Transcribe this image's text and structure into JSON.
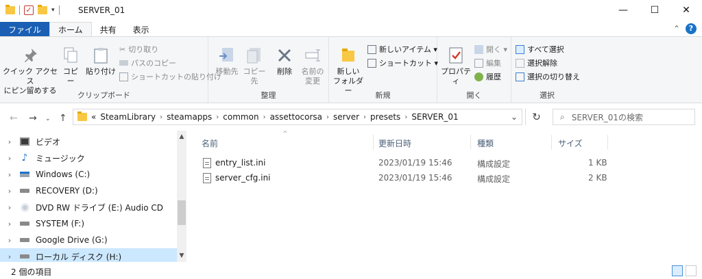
{
  "window": {
    "title": "SERVER_01",
    "minimize": "—",
    "maximize": "☐",
    "close": "✕"
  },
  "tabs": {
    "file": "ファイル",
    "home": "ホーム",
    "share": "共有",
    "view": "表示"
  },
  "ribbon": {
    "clipboard": {
      "label": "クリップボード",
      "pin_line1": "クイック アクセス",
      "pin_line2": "にピン留めする",
      "copy": "コピー",
      "paste": "貼り付け",
      "cut": "切り取り",
      "copy_path": "パスのコピー",
      "paste_shortcut": "ショートカットの貼り付け"
    },
    "organize": {
      "label": "整理",
      "move_to": "移動先",
      "copy_to": "コピー先",
      "delete": "削除",
      "rename_line1": "名前の",
      "rename_line2": "変更"
    },
    "new": {
      "label": "新規",
      "new_folder_line1": "新しい",
      "new_folder_line2": "フォルダー",
      "new_item": "新しいアイテム ▾",
      "easy_access": "ショートカット ▾"
    },
    "open": {
      "label": "開く",
      "properties": "プロパティ",
      "open": "開く ▾",
      "edit": "編集",
      "history": "履歴"
    },
    "select": {
      "label": "選択",
      "select_all": "すべて選択",
      "select_none": "選択解除",
      "invert": "選択の切り替え"
    }
  },
  "address": {
    "prefix": "«",
    "crumbs": [
      "SteamLibrary",
      "steamapps",
      "common",
      "assettocorsa",
      "server",
      "presets",
      "SERVER_01"
    ],
    "search_placeholder": "SERVER_01の検索"
  },
  "nav": [
    {
      "label": "ビデオ",
      "icon": "video-icon"
    },
    {
      "label": "ミュージック",
      "icon": "music-icon"
    },
    {
      "label": "Windows (C:)",
      "icon": "windows-drive-icon"
    },
    {
      "label": "RECOVERY (D:)",
      "icon": "drive-icon"
    },
    {
      "label": "DVD RW ドライブ (E:) Audio CD",
      "icon": "dvd-icon"
    },
    {
      "label": "SYSTEM (F:)",
      "icon": "drive-icon"
    },
    {
      "label": "Google Drive (G:)",
      "icon": "drive-icon"
    },
    {
      "label": "ローカル ディスク (H:)",
      "icon": "drive-icon"
    }
  ],
  "columns": {
    "name": "名前",
    "modified": "更新日時",
    "type": "種類",
    "size": "サイズ"
  },
  "files": [
    {
      "name": "entry_list.ini",
      "modified": "2023/01/19 15:46",
      "type": "構成設定",
      "size": "1 KB"
    },
    {
      "name": "server_cfg.ini",
      "modified": "2023/01/19 15:46",
      "type": "構成設定",
      "size": "2 KB"
    }
  ],
  "status": {
    "count": "2 個の項目"
  },
  "colors": {
    "accent": "#1a5fb4",
    "selection": "#cce8ff",
    "folder": "#f8c844"
  }
}
